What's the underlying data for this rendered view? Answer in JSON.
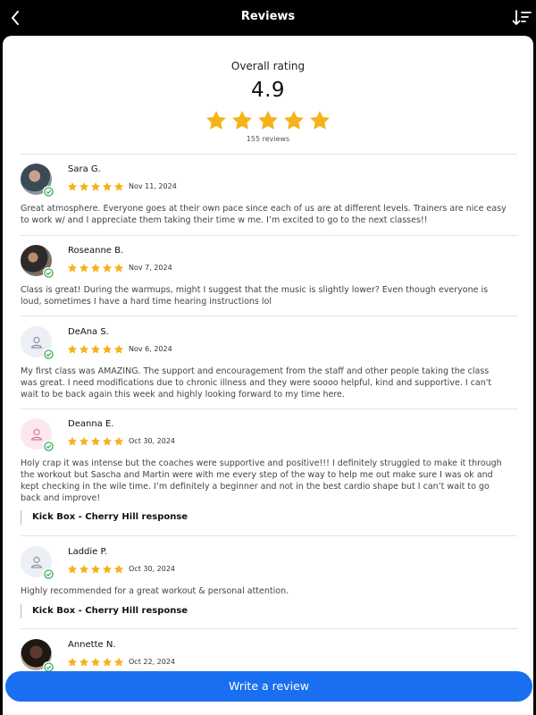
{
  "header": {
    "title": "Reviews",
    "back_icon": "chevron-left-icon",
    "sort_icon": "sort-descending-icon"
  },
  "overall": {
    "label": "Overall rating",
    "score": "4.9",
    "stars": 5,
    "count": "155 reviews"
  },
  "colors": {
    "star": "#f5b21a",
    "accent": "#1a6ff0",
    "verified": "#22a447"
  },
  "reviews": [
    {
      "name": "Sara G.",
      "stars": 5,
      "date": "Nov 11, 2024",
      "avatar": "photo",
      "text": "Great atmosphere. Everyone goes at their own pace since each of us are at different levels. Trainers are nice easy to work w/ and I appreciate them taking their time w me. I’m excited to go to the next classes!!"
    },
    {
      "name": "Roseanne B.",
      "stars": 5,
      "date": "Nov 7, 2024",
      "avatar": "photo",
      "text": "Class is great! During the warmups, might I suggest that the music is slightly lower? Even though everyone is loud, sometimes I have a hard time hearing instructions lol"
    },
    {
      "name": "DeAna S.",
      "stars": 5,
      "date": "Nov 6, 2024",
      "avatar": "placeholder",
      "text": "My first class was AMAZING. The support and encouragement from the staff and other people taking the class was great. I need modifications due to chronic illness and they were soooo helpful, kind and supportive. I can't wait to be back again this week and highly looking forward to my time here."
    },
    {
      "name": "Deanna E.",
      "stars": 5,
      "date": "Oct 30, 2024",
      "avatar": "pink-placeholder",
      "text": "Holy crap it was intense but the coaches were supportive and positive!!! I definitely struggled to make it through the workout but Sascha and Martin were with me every step of the way to help me out make sure I was ok and kept checking in the wile time. I’m definitely a beginner and not in the best cardio shape but I can’t wait to go back and improve!",
      "response": "Kick Box - Cherry Hill response"
    },
    {
      "name": "Laddie P.",
      "stars": 5,
      "date": "Oct 30, 2024",
      "avatar": "placeholder",
      "text": "Highly recommended for a great workout & personal attention.",
      "response": "Kick Box - Cherry Hill response"
    },
    {
      "name": "Annette N.",
      "stars": 5,
      "date": "Oct 22, 2024",
      "avatar": "photo",
      "text": ""
    }
  ],
  "footer": {
    "write_review": "Write a review"
  }
}
